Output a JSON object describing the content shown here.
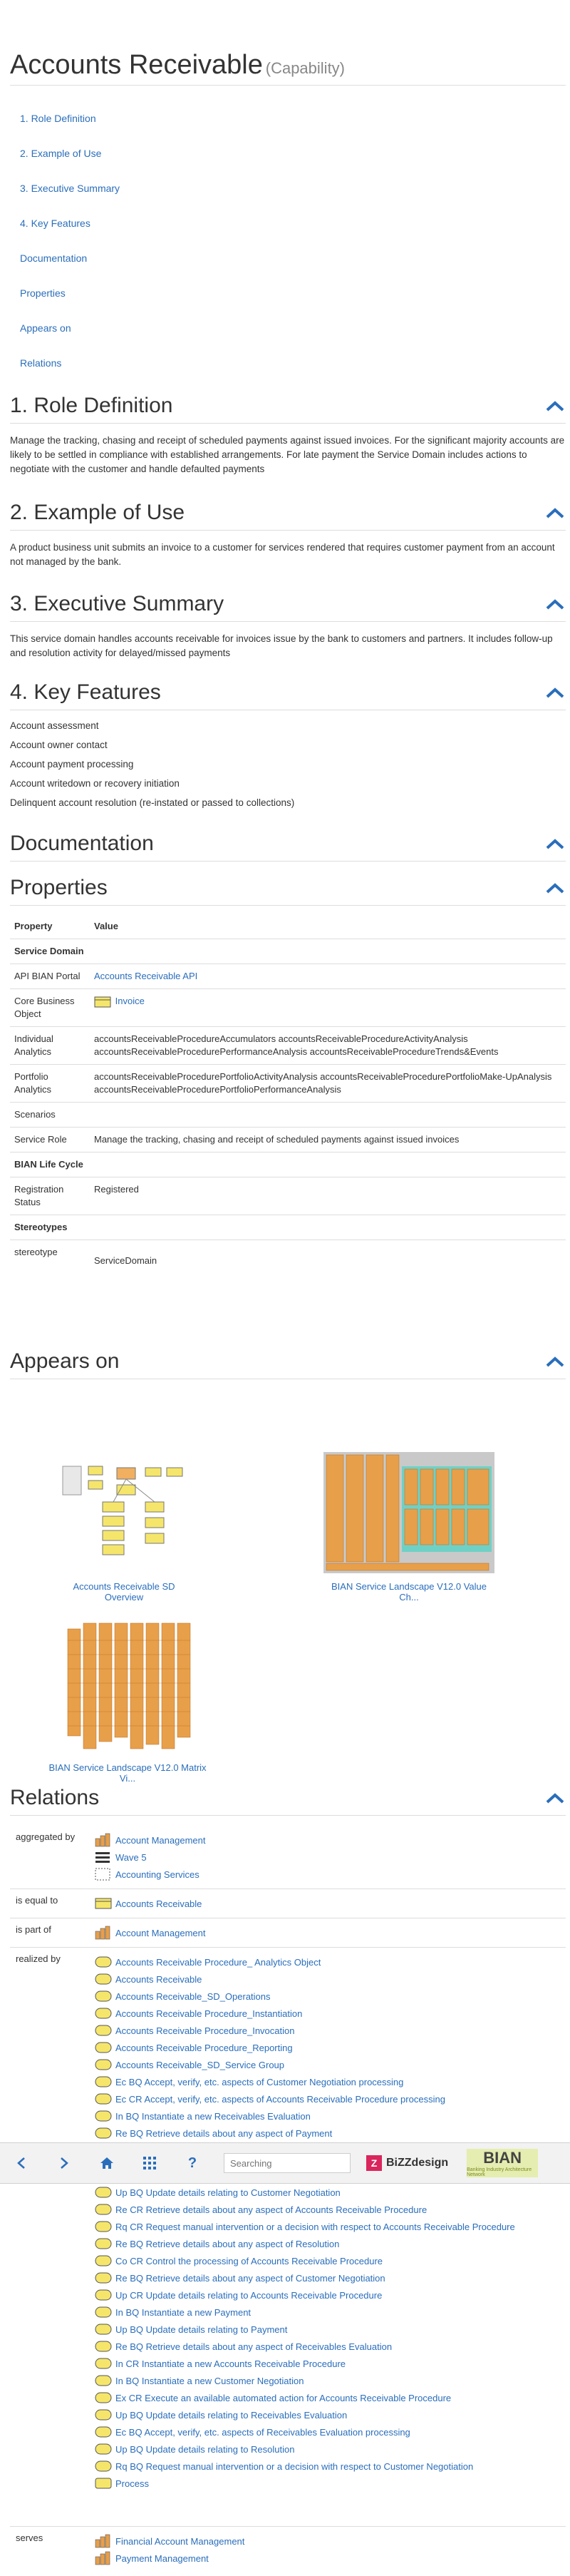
{
  "header": {
    "title": "Accounts Receivable",
    "subtitle": "(Capability)"
  },
  "toc": [
    "1. Role Definition",
    "2. Example of Use",
    "3. Executive Summary",
    "4. Key Features",
    "Documentation",
    "Properties",
    "Appears on",
    "Relations"
  ],
  "sections": {
    "role": {
      "title": "1. Role Definition",
      "text": "Manage the tracking, chasing and receipt of scheduled payments against issued invoices. For the significant majority accounts are likely to be settled in compliance with established arrangements. For late payment the Service Domain includes actions to negotiate with the customer and handle defaulted payments"
    },
    "example": {
      "title": "2. Example of Use",
      "text": "A product business unit submits an invoice to a customer for services rendered that requires customer payment from an account not managed by the bank."
    },
    "summary": {
      "title": "3. Executive Summary",
      "text": "This service domain handles accounts receivable for invoices issue by the bank to customers and partners. It includes follow-up and resolution activity for delayed/missed payments"
    },
    "features": {
      "title": "4. Key Features",
      "items": [
        "Account assessment",
        "Account owner contact",
        "Account payment processing",
        "Account writedown or recovery initiation",
        "Delinquent account resolution (re-instated or passed to collections)"
      ]
    },
    "documentation": {
      "title": "Documentation"
    },
    "properties": {
      "title": "Properties",
      "col_property": "Property",
      "col_value": "Value",
      "group_service_domain": "Service Domain",
      "api_label": "API BIAN Portal",
      "api_value": "Accounts Receivable API",
      "cbo_label": "Core Business Object",
      "cbo_value": "Invoice",
      "ind_label": "Individual Analytics",
      "ind_value": "accountsReceivableProcedureAccumulators accountsReceivableProcedureActivityAnalysis accountsReceivableProcedurePerformanceAnalysis accountsReceivableProcedureTrends&Events",
      "port_label": "Portfolio Analytics",
      "port_value": "accountsReceivableProcedurePortfolioActivityAnalysis accountsReceivableProcedurePortfolioMake-UpAnalysis accountsReceivableProcedurePortfolioPerformanceAnalysis",
      "scen_label": "Scenarios",
      "role_label": "Service Role",
      "role_value": "Manage the tracking, chasing and receipt of scheduled payments against issued invoices",
      "group_lifecycle": "BIAN Life Cycle",
      "reg_label": "Registration Status",
      "reg_value": "Registered",
      "group_stereo": "Stereotypes",
      "stereo_label": "stereotype",
      "stereo_value": "ServiceDomain"
    },
    "appears": {
      "title": "Appears on",
      "items": [
        "Accounts Receivable SD Overview",
        "BIAN Service Landscape V12.0 Value Ch...",
        "BIAN Service Landscape V12.0 Matrix Vi..."
      ]
    },
    "relations": {
      "title": "Relations",
      "aggregated_label": "aggregated by",
      "aggregated": [
        "Account Management",
        "Wave 5",
        "Accounting Services"
      ],
      "equal_label": "is equal to",
      "equal": [
        "Accounts Receivable"
      ],
      "partof_label": "is part of",
      "partof": [
        "Account Management"
      ],
      "realized_label": "realized by",
      "realized": [
        "Accounts Receivable Procedure_ Analytics Object",
        "Accounts Receivable",
        "Accounts Receivable_SD_Operations",
        "Accounts Receivable Procedure_Instantiation",
        "Accounts Receivable Procedure_Invocation",
        "Accounts Receivable Procedure_Reporting",
        "Accounts Receivable_SD_Service Group",
        "Ec BQ Accept, verify, etc. aspects of Customer Negotiation processing",
        "Ec CR Accept, verify, etc. aspects of Accounts Receivable Procedure processing",
        "In BQ Instantiate a new Receivables Evaluation",
        "Re BQ Retrieve details about any aspect of Payment"
      ],
      "realized_after": [
        "Up BQ Update details relating to Customer Negotiation",
        "Re CR Retrieve details about any aspect of Accounts Receivable Procedure",
        "Rq CR Request manual intervention or a decision with respect to Accounts Receivable Procedure",
        "Re BQ Retrieve details about any aspect of Resolution",
        "Co CR Control the processing of Accounts Receivable Procedure",
        "Re BQ Retrieve details about any aspect of Customer Negotiation",
        "Up CR Update details relating to Accounts Receivable Procedure",
        "In BQ Instantiate a new Payment",
        "Up BQ Update details relating to Payment",
        "Re BQ Retrieve details about any aspect of Receivables Evaluation",
        "In CR Instantiate a new Accounts Receivable Procedure",
        "In BQ Instantiate a new Customer Negotiation",
        "Ex CR Execute an available automated action for Accounts Receivable Procedure",
        "Up BQ Update details relating to Receivables Evaluation",
        "Ec BQ Accept, verify, etc. aspects of Receivables Evaluation processing",
        "Up BQ Update details relating to Resolution",
        "Rq BQ Request manual intervention or a decision with respect to Customer Negotiation",
        "Process"
      ],
      "serves_label": "serves",
      "serves": [
        "Financial Account Management",
        "Payment Management"
      ]
    }
  },
  "toolbar": {
    "search_placeholder": "Searching",
    "bizzdesign": "BiZZdesign",
    "bian": "BIAN",
    "bian_tag": "Banking Industry Architecture Network"
  },
  "colors": {
    "link": "#2a6ebb",
    "accent": "#2a6ebb",
    "object_yellow": "#f5e66b",
    "grid_orange": "#e89f4a"
  }
}
